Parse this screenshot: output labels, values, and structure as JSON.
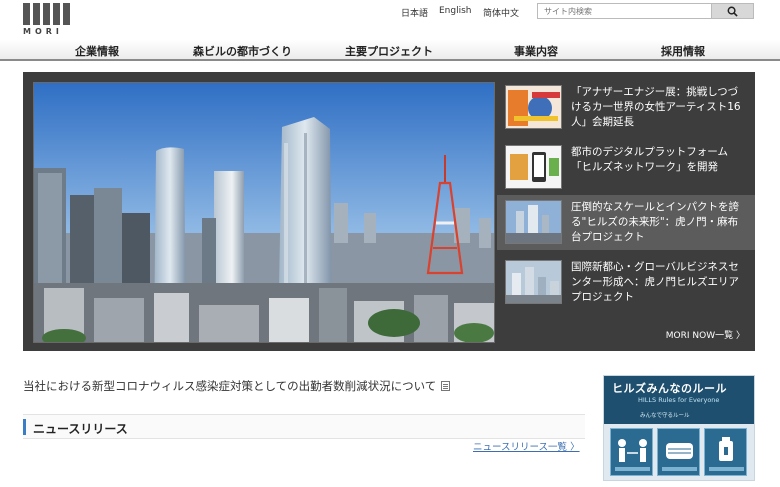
{
  "header": {
    "logo_text": "MORI",
    "languages": [
      "日本語",
      "English",
      "简体中文"
    ],
    "search_placeholder": "サイト内検索"
  },
  "nav": {
    "items": [
      "企業情報",
      "森ビルの都市づくり",
      "主要プロジェクト",
      "事業内容",
      "採用情報"
    ]
  },
  "hero": {
    "news": [
      {
        "text": "「アナザーエナジー展：挑戦しつづけるカ一世界の女性アーティスト16人」会期延長"
      },
      {
        "text": "都市のデジタルプラットフォーム「ヒルズネットワーク」を開発"
      },
      {
        "text": "圧倒的なスケールとインパクトを誇る\"ヒルズの未来形\"：虎ノ門・麻布台プロジェクト"
      },
      {
        "text": "国際新都心・グローバルビジネスセンター形成へ：虎ノ門ヒルズエリアプロジェクト"
      }
    ],
    "more_label": "MORI NOW一覧 〉"
  },
  "notice": {
    "text": "当社における新型コロナウィルス感染症対策としての出勤者数削減状況について"
  },
  "news_release": {
    "title": "ニュースリリース",
    "link_label": "ニュースリリース一覧 〉"
  },
  "banner": {
    "title": "ヒルズみんなのルール",
    "subtitle": "HILLS Rules for Everyone",
    "note": "みんなで守るルール"
  }
}
